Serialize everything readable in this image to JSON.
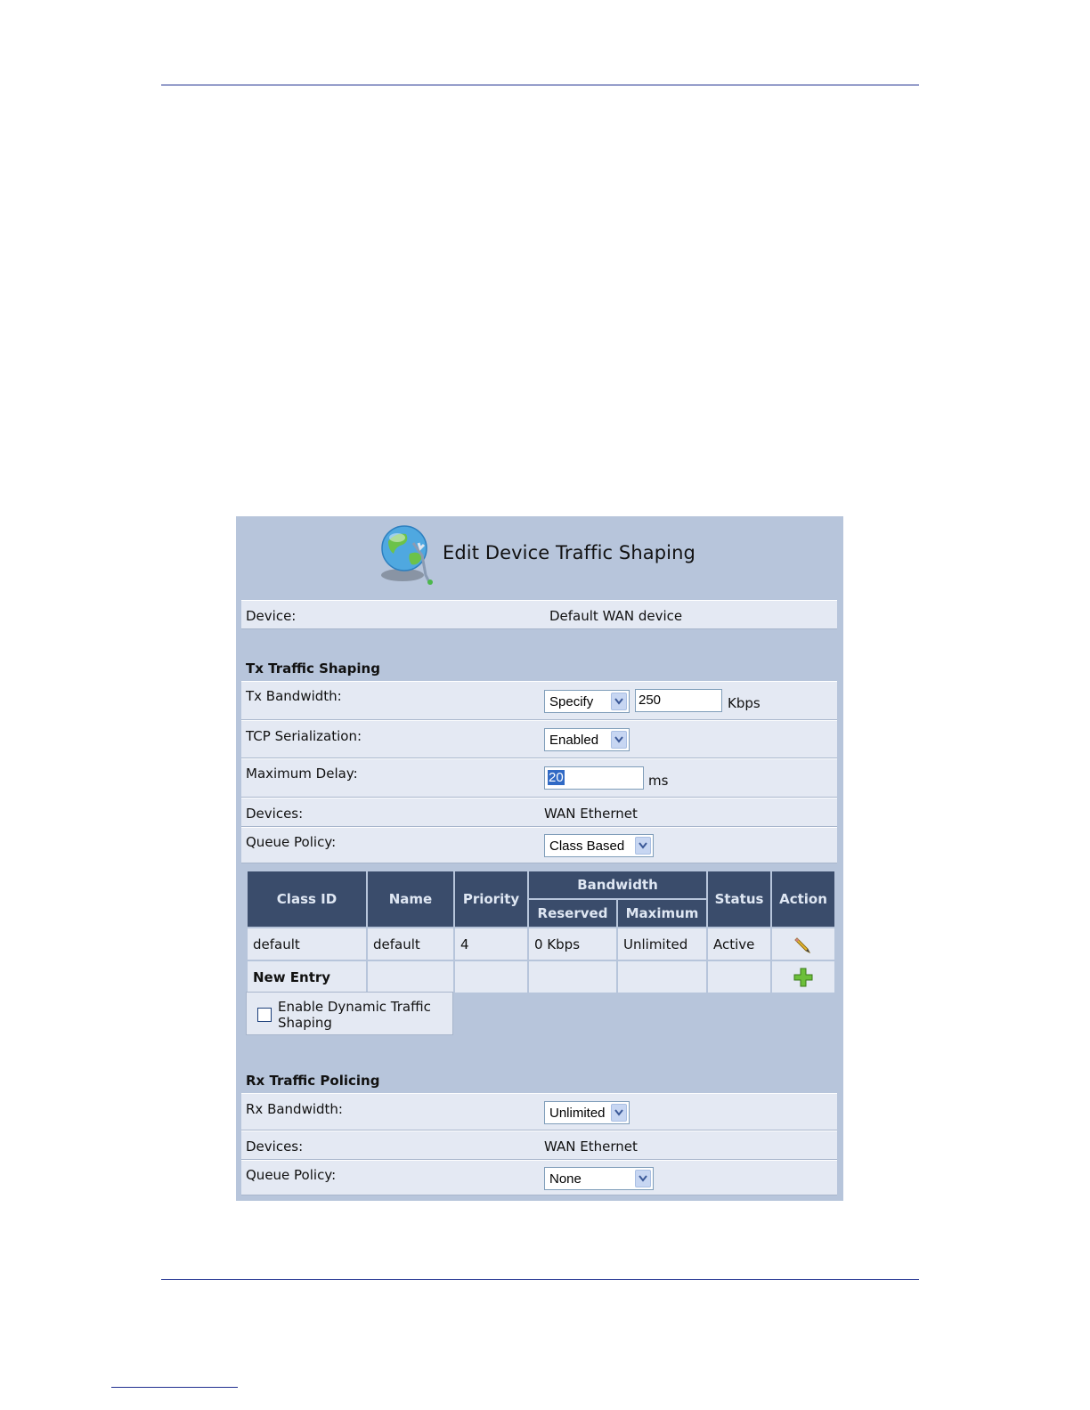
{
  "page": {
    "title": "Edit Device Traffic Shaping",
    "device_label": "Device:",
    "device_value": "Default WAN device"
  },
  "tx": {
    "section_title": "Tx Traffic Shaping",
    "bandwidth_label": "Tx Bandwidth:",
    "bandwidth_mode": "Specify",
    "bandwidth_value": "250",
    "bandwidth_unit": "Kbps",
    "tcp_label": "TCP Serialization:",
    "tcp_value": "Enabled",
    "delay_label": "Maximum Delay:",
    "delay_value": "20",
    "delay_unit": "ms",
    "devices_label": "Devices:",
    "devices_value": "WAN Ethernet",
    "queue_label": "Queue Policy:",
    "queue_value": "Class Based"
  },
  "classes_table": {
    "headers": {
      "class_id": "Class ID",
      "name": "Name",
      "priority": "Priority",
      "bandwidth": "Bandwidth",
      "reserved": "Reserved",
      "maximum": "Maximum",
      "status": "Status",
      "action": "Action"
    },
    "rows": [
      {
        "class_id": "default",
        "name": "default",
        "priority": "4",
        "reserved": "0 Kbps",
        "maximum": "Unlimited",
        "status": "Active",
        "action_icon": "pencil-icon"
      }
    ],
    "new_entry_label": "New Entry",
    "new_entry_icon": "plus-icon"
  },
  "dynamic": {
    "label_line1": "Enable Dynamic Traffic",
    "label_line2": "Shaping",
    "checked": false
  },
  "rx": {
    "section_title": "Rx Traffic Policing",
    "bandwidth_label": "Rx Bandwidth:",
    "bandwidth_mode": "Unlimited",
    "devices_label": "Devices:",
    "devices_value": "WAN Ethernet",
    "queue_label": "Queue Policy:",
    "queue_value": "None"
  },
  "colors": {
    "panel_bg": "#b7c5db",
    "row_bg": "#e4e9f3",
    "header_bg": "#3a4c6b",
    "active_status": "#1c8b1c"
  }
}
